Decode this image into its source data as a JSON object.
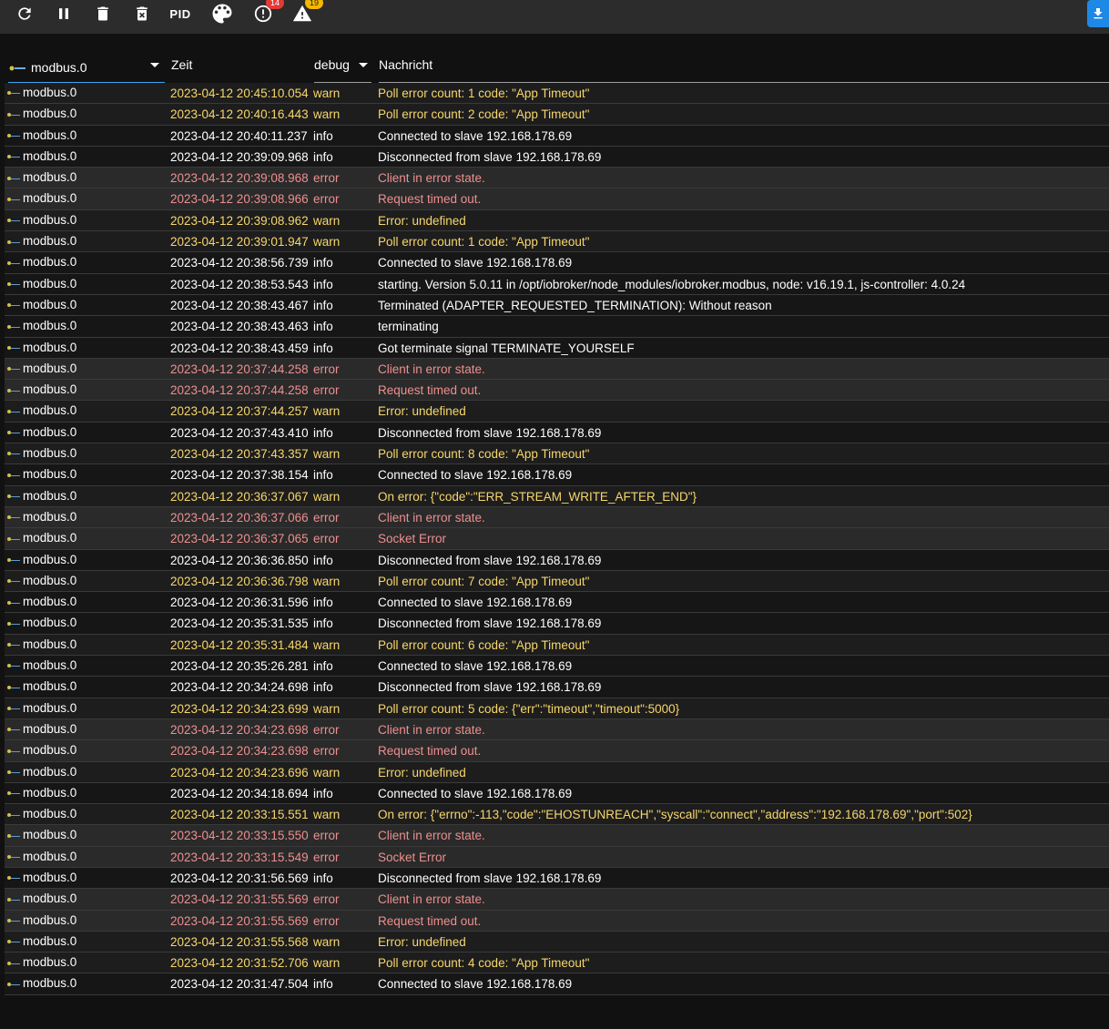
{
  "toolbar": {
    "pid_label": "PID",
    "error_count": "14",
    "warn_count": "19"
  },
  "header": {
    "source_filter": "modbus.0",
    "time_label": "Zeit",
    "severity_filter": "debug",
    "message_label": "Nachricht"
  },
  "rows": [
    {
      "src": "modbus.0",
      "time": "2023-04-12 20:45:10.054",
      "sev": "warn",
      "msg": "Poll error count: 1 code: \"App Timeout\""
    },
    {
      "src": "modbus.0",
      "time": "2023-04-12 20:40:16.443",
      "sev": "warn",
      "msg": "Poll error count: 2 code: \"App Timeout\""
    },
    {
      "src": "modbus.0",
      "time": "2023-04-12 20:40:11.237",
      "sev": "info",
      "msg": "Connected to slave 192.168.178.69"
    },
    {
      "src": "modbus.0",
      "time": "2023-04-12 20:39:09.968",
      "sev": "info",
      "msg": "Disconnected from slave 192.168.178.69"
    },
    {
      "src": "modbus.0",
      "time": "2023-04-12 20:39:08.968",
      "sev": "error",
      "msg": "Client in error state."
    },
    {
      "src": "modbus.0",
      "time": "2023-04-12 20:39:08.966",
      "sev": "error",
      "msg": "Request timed out."
    },
    {
      "src": "modbus.0",
      "time": "2023-04-12 20:39:08.962",
      "sev": "warn",
      "msg": "Error: undefined"
    },
    {
      "src": "modbus.0",
      "time": "2023-04-12 20:39:01.947",
      "sev": "warn",
      "msg": "Poll error count: 1 code: \"App Timeout\""
    },
    {
      "src": "modbus.0",
      "time": "2023-04-12 20:38:56.739",
      "sev": "info",
      "msg": "Connected to slave 192.168.178.69"
    },
    {
      "src": "modbus.0",
      "time": "2023-04-12 20:38:53.543",
      "sev": "info",
      "msg": "starting. Version 5.0.11 in /opt/iobroker/node_modules/iobroker.modbus, node: v16.19.1, js-controller: 4.0.24"
    },
    {
      "src": "modbus.0",
      "time": "2023-04-12 20:38:43.467",
      "sev": "info",
      "msg": "Terminated (ADAPTER_REQUESTED_TERMINATION): Without reason"
    },
    {
      "src": "modbus.0",
      "time": "2023-04-12 20:38:43.463",
      "sev": "info",
      "msg": "terminating"
    },
    {
      "src": "modbus.0",
      "time": "2023-04-12 20:38:43.459",
      "sev": "info",
      "msg": "Got terminate signal TERMINATE_YOURSELF"
    },
    {
      "src": "modbus.0",
      "time": "2023-04-12 20:37:44.258",
      "sev": "error",
      "msg": "Client in error state."
    },
    {
      "src": "modbus.0",
      "time": "2023-04-12 20:37:44.258",
      "sev": "error",
      "msg": "Request timed out."
    },
    {
      "src": "modbus.0",
      "time": "2023-04-12 20:37:44.257",
      "sev": "warn",
      "msg": "Error: undefined"
    },
    {
      "src": "modbus.0",
      "time": "2023-04-12 20:37:43.410",
      "sev": "info",
      "msg": "Disconnected from slave 192.168.178.69"
    },
    {
      "src": "modbus.0",
      "time": "2023-04-12 20:37:43.357",
      "sev": "warn",
      "msg": "Poll error count: 8 code: \"App Timeout\""
    },
    {
      "src": "modbus.0",
      "time": "2023-04-12 20:37:38.154",
      "sev": "info",
      "msg": "Connected to slave 192.168.178.69"
    },
    {
      "src": "modbus.0",
      "time": "2023-04-12 20:36:37.067",
      "sev": "warn",
      "msg": "On error: {\"code\":\"ERR_STREAM_WRITE_AFTER_END\"}"
    },
    {
      "src": "modbus.0",
      "time": "2023-04-12 20:36:37.066",
      "sev": "error",
      "msg": "Client in error state."
    },
    {
      "src": "modbus.0",
      "time": "2023-04-12 20:36:37.065",
      "sev": "error",
      "msg": "Socket Error"
    },
    {
      "src": "modbus.0",
      "time": "2023-04-12 20:36:36.850",
      "sev": "info",
      "msg": "Disconnected from slave 192.168.178.69"
    },
    {
      "src": "modbus.0",
      "time": "2023-04-12 20:36:36.798",
      "sev": "warn",
      "msg": "Poll error count: 7 code: \"App Timeout\""
    },
    {
      "src": "modbus.0",
      "time": "2023-04-12 20:36:31.596",
      "sev": "info",
      "msg": "Connected to slave 192.168.178.69"
    },
    {
      "src": "modbus.0",
      "time": "2023-04-12 20:35:31.535",
      "sev": "info",
      "msg": "Disconnected from slave 192.168.178.69"
    },
    {
      "src": "modbus.0",
      "time": "2023-04-12 20:35:31.484",
      "sev": "warn",
      "msg": "Poll error count: 6 code: \"App Timeout\""
    },
    {
      "src": "modbus.0",
      "time": "2023-04-12 20:35:26.281",
      "sev": "info",
      "msg": "Connected to slave 192.168.178.69"
    },
    {
      "src": "modbus.0",
      "time": "2023-04-12 20:34:24.698",
      "sev": "info",
      "msg": "Disconnected from slave 192.168.178.69"
    },
    {
      "src": "modbus.0",
      "time": "2023-04-12 20:34:23.699",
      "sev": "warn",
      "msg": "Poll error count: 5 code: {\"err\":\"timeout\",\"timeout\":5000}"
    },
    {
      "src": "modbus.0",
      "time": "2023-04-12 20:34:23.698",
      "sev": "error",
      "msg": "Client in error state."
    },
    {
      "src": "modbus.0",
      "time": "2023-04-12 20:34:23.698",
      "sev": "error",
      "msg": "Request timed out."
    },
    {
      "src": "modbus.0",
      "time": "2023-04-12 20:34:23.696",
      "sev": "warn",
      "msg": "Error: undefined"
    },
    {
      "src": "modbus.0",
      "time": "2023-04-12 20:34:18.694",
      "sev": "info",
      "msg": "Connected to slave 192.168.178.69"
    },
    {
      "src": "modbus.0",
      "time": "2023-04-12 20:33:15.551",
      "sev": "warn",
      "msg": "On error: {\"errno\":-113,\"code\":\"EHOSTUNREACH\",\"syscall\":\"connect\",\"address\":\"192.168.178.69\",\"port\":502}"
    },
    {
      "src": "modbus.0",
      "time": "2023-04-12 20:33:15.550",
      "sev": "error",
      "msg": "Client in error state."
    },
    {
      "src": "modbus.0",
      "time": "2023-04-12 20:33:15.549",
      "sev": "error",
      "msg": "Socket Error"
    },
    {
      "src": "modbus.0",
      "time": "2023-04-12 20:31:56.569",
      "sev": "info",
      "msg": "Disconnected from slave 192.168.178.69"
    },
    {
      "src": "modbus.0",
      "time": "2023-04-12 20:31:55.569",
      "sev": "error",
      "msg": "Client in error state."
    },
    {
      "src": "modbus.0",
      "time": "2023-04-12 20:31:55.569",
      "sev": "error",
      "msg": "Request timed out."
    },
    {
      "src": "modbus.0",
      "time": "2023-04-12 20:31:55.568",
      "sev": "warn",
      "msg": "Error: undefined"
    },
    {
      "src": "modbus.0",
      "time": "2023-04-12 20:31:52.706",
      "sev": "warn",
      "msg": "Poll error count: 4 code: \"App Timeout\""
    },
    {
      "src": "modbus.0",
      "time": "2023-04-12 20:31:47.504",
      "sev": "info",
      "msg": "Connected to slave 192.168.178.69"
    }
  ]
}
